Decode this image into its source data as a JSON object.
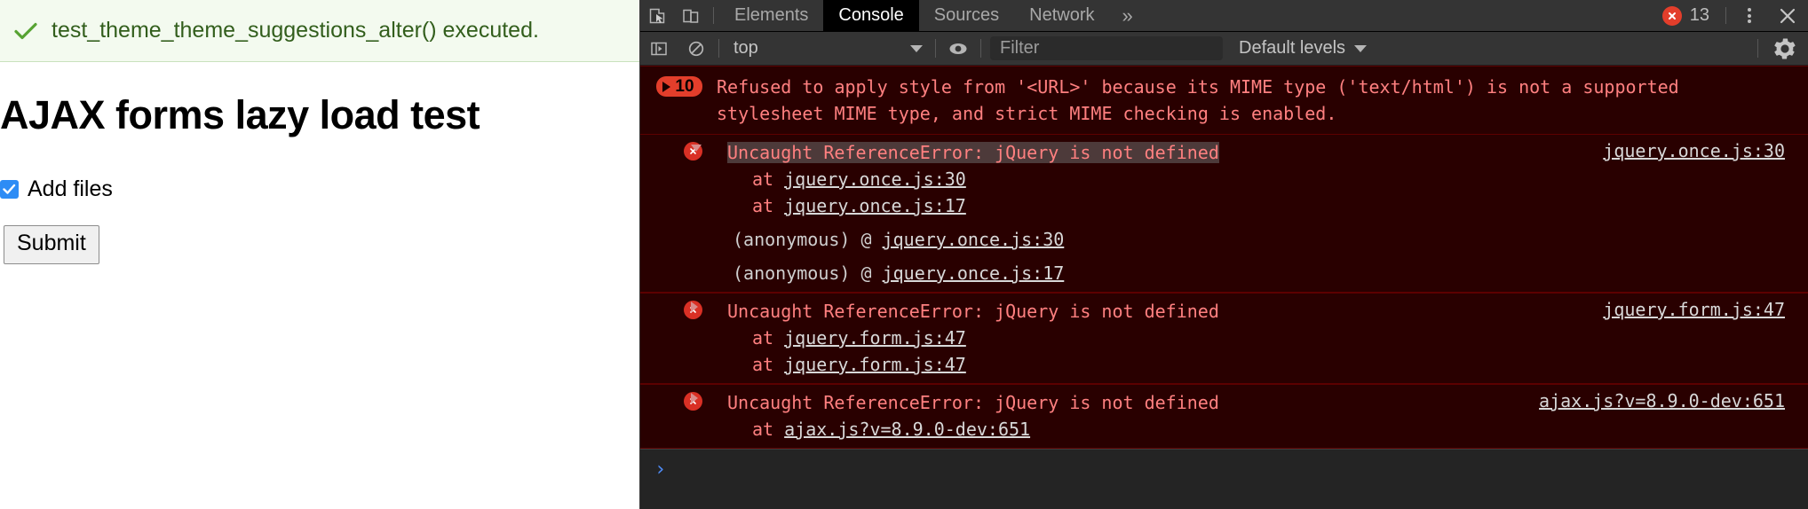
{
  "page": {
    "status_message": {
      "icon": "check-icon",
      "text": "test_theme_theme_suggestions_alter() executed."
    },
    "title": "AJAX forms lazy load test",
    "checkbox": {
      "label": "Add files",
      "checked": true
    },
    "submit_label": "Submit"
  },
  "devtools": {
    "toolbar": {
      "inspect_icon": "inspect-element-icon",
      "device_icon": "device-toolbar-icon",
      "tabs": [
        {
          "label": "Elements",
          "active": false
        },
        {
          "label": "Console",
          "active": true
        },
        {
          "label": "Sources",
          "active": false
        },
        {
          "label": "Network",
          "active": false
        }
      ],
      "more_tabs": "»",
      "error_count": "13",
      "error_icon": "error-circle-icon",
      "kebab_icon": "more-options-icon",
      "close_icon": "close-icon"
    },
    "filterbar": {
      "sidebar_icon": "console-sidebar-icon",
      "clear_icon": "clear-console-icon",
      "context": "top",
      "eye_icon": "live-expression-icon",
      "filter_placeholder": "Filter",
      "filter_value": "",
      "levels": "Default levels",
      "settings_icon": "gear-icon"
    },
    "console": {
      "messages": [
        {
          "kind": "grouped-warning",
          "count": "10",
          "text": "Refused to apply style from '<URL>' because its MIME type ('text/html') is not a supported stylesheet MIME type, and strict MIME checking is enabled."
        },
        {
          "kind": "error",
          "expanded": true,
          "title": "Uncaught ReferenceError: jQuery is not defined",
          "source": "jquery.once.js:30",
          "stack": [
            {
              "prefix": "at ",
              "link": "jquery.once.js:30"
            },
            {
              "prefix": "at ",
              "link": "jquery.once.js:17"
            }
          ],
          "anon_frames": [
            {
              "prefix": "(anonymous) @ ",
              "link": "jquery.once.js:30"
            },
            {
              "prefix": "(anonymous) @ ",
              "link": "jquery.once.js:17"
            }
          ]
        },
        {
          "kind": "error",
          "expanded": false,
          "title": "Uncaught ReferenceError: jQuery is not defined",
          "source": "jquery.form.js:47",
          "stack": [
            {
              "prefix": "at ",
              "link": "jquery.form.js:47"
            },
            {
              "prefix": "at ",
              "link": "jquery.form.js:47"
            }
          ],
          "anon_frames": []
        },
        {
          "kind": "error",
          "expanded": false,
          "title": "Uncaught ReferenceError: jQuery is not defined",
          "source": "ajax.js?v=8.9.0-dev:651",
          "stack": [
            {
              "prefix": "at ",
              "link": "ajax.js?v=8.9.0-dev:651"
            }
          ],
          "anon_frames": []
        }
      ],
      "prompt": "›"
    }
  }
}
